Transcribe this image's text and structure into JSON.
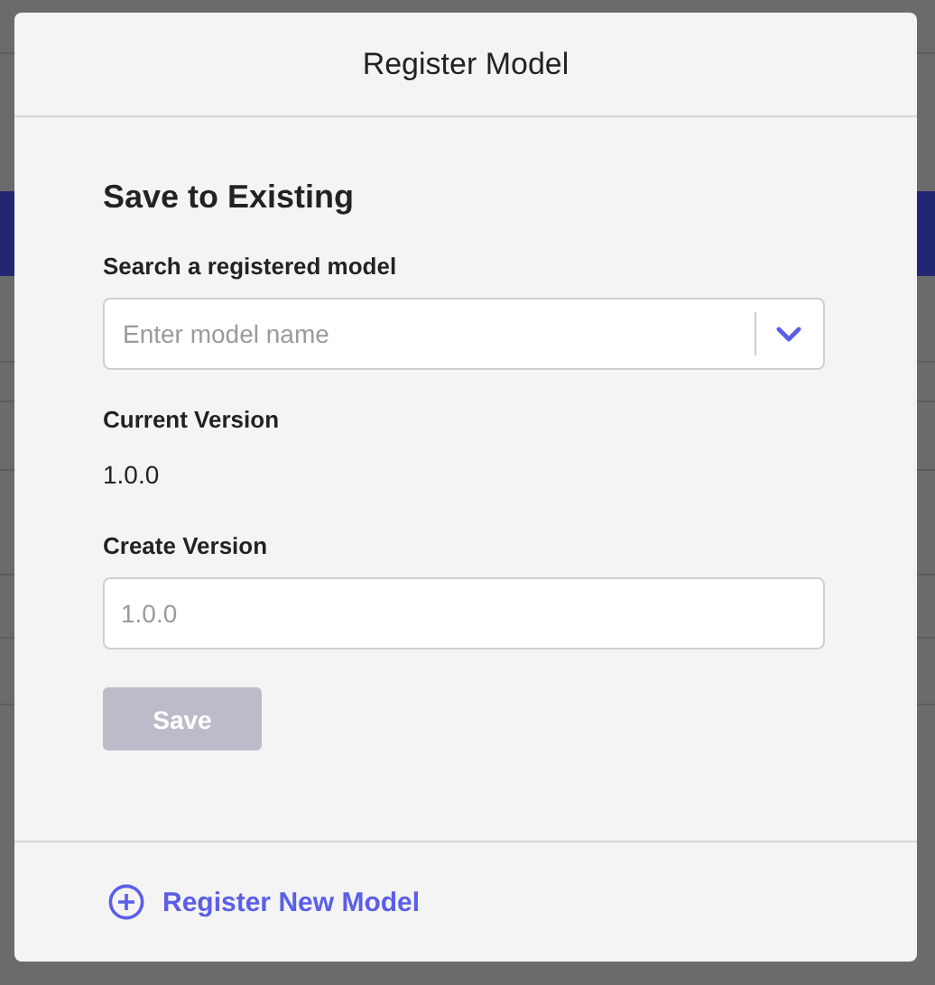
{
  "dialog": {
    "title": "Register Model"
  },
  "section": {
    "heading": "Save to Existing"
  },
  "search": {
    "label": "Search a registered model",
    "placeholder": "Enter model name"
  },
  "current_version": {
    "label": "Current Version",
    "value": "1.0.0"
  },
  "create_version": {
    "label": "Create Version",
    "placeholder": "1.0.0"
  },
  "save_button": {
    "label": "Save",
    "disabled": true
  },
  "footer_link": {
    "label": "Register New Model"
  }
}
